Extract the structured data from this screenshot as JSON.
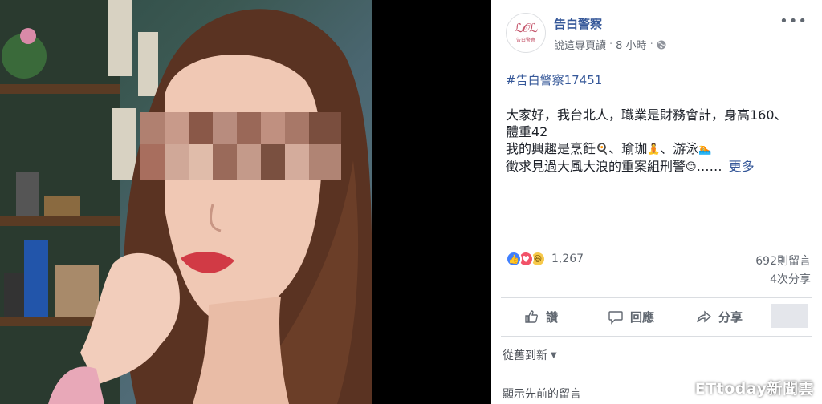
{
  "post": {
    "page_name": "告白警察",
    "avatar_logo_text": "ℒ𝒪ℒ",
    "avatar_logo_sub": "告白警察",
    "meta_author": "說這專頁讀",
    "meta_time": "8 小時",
    "hashtag": "#告白警察17451",
    "body_lines": [
      "大家好，我台北人，職業是財務會計，身高160、",
      "體重42",
      "我的興趣是烹飪",
      "、瑜珈",
      "、游泳",
      "徵求見過大風大浪的重案組刑警",
      "……"
    ],
    "see_more": "更多",
    "reaction_count": "1,267",
    "comments_count": "692則留言",
    "shares_count": "4次分享"
  },
  "actions": {
    "like": "讚",
    "comment": "回應",
    "share": "分享"
  },
  "comments": {
    "sort_label": "從舊到新",
    "view_previous": "顯示先前的留言"
  },
  "watermark": "ETtoday新聞雲",
  "colors": {
    "link_blue": "#365899",
    "like_blue": "#4080ff",
    "love_red": "#f25268",
    "haha_yellow": "#f7c94a"
  }
}
